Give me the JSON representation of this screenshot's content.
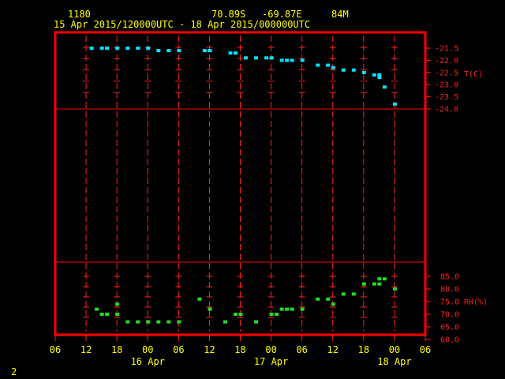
{
  "header": {
    "station_id": "1180",
    "lat": "70.89S",
    "lon": "-69.87E",
    "elevation": "84M",
    "time_range": "15 Apr 2015/120000UTC - 18 Apr 2015/000000UTC"
  },
  "page_number": "2",
  "colors": {
    "background": "#000000",
    "frame": "#ff0000",
    "grid": "#ff2020",
    "axis_text": "#ffff00",
    "temperature": "#00e5ff",
    "humidity": "#22dd22"
  },
  "chart_data": [
    {
      "type": "scatter",
      "panel": "top",
      "ylabel": "T(C)",
      "yticks": [
        "-21.5",
        "-22.0",
        "-22.5",
        "-23.0",
        "-23.5",
        "-24.0"
      ],
      "ylim": [
        -24.0,
        -21.5
      ],
      "y_inverted": true,
      "series": [
        {
          "points": [
            {
              "x": "2015-04-15T13:00",
              "y": -21.5
            },
            {
              "x": "2015-04-15T15:00",
              "y": -21.5
            },
            {
              "x": "2015-04-15T16:00",
              "y": -21.5
            },
            {
              "x": "2015-04-15T18:00",
              "y": -21.5
            },
            {
              "x": "2015-04-15T20:00",
              "y": -21.5
            },
            {
              "x": "2015-04-15T22:00",
              "y": -21.5
            },
            {
              "x": "2015-04-16T00:00",
              "y": -21.5
            },
            {
              "x": "2015-04-16T02:00",
              "y": -21.6
            },
            {
              "x": "2015-04-16T04:00",
              "y": -21.6
            },
            {
              "x": "2015-04-16T06:00",
              "y": -21.6
            },
            {
              "x": "2015-04-16T11:00",
              "y": -21.6
            },
            {
              "x": "2015-04-16T12:00",
              "y": -21.6
            },
            {
              "x": "2015-04-16T16:00",
              "y": -21.7
            },
            {
              "x": "2015-04-16T17:00",
              "y": -21.7
            },
            {
              "x": "2015-04-16T19:00",
              "y": -21.9
            },
            {
              "x": "2015-04-16T21:00",
              "y": -21.9
            },
            {
              "x": "2015-04-16T23:00",
              "y": -21.9
            },
            {
              "x": "2015-04-17T00:00",
              "y": -21.9
            },
            {
              "x": "2015-04-17T02:00",
              "y": -22.0
            },
            {
              "x": "2015-04-17T03:00",
              "y": -22.0
            },
            {
              "x": "2015-04-17T04:00",
              "y": -22.0
            },
            {
              "x": "2015-04-17T06:00",
              "y": -22.0
            },
            {
              "x": "2015-04-17T09:00",
              "y": -22.2
            },
            {
              "x": "2015-04-17T11:00",
              "y": -22.2
            },
            {
              "x": "2015-04-17T12:00",
              "y": -22.3
            },
            {
              "x": "2015-04-17T14:00",
              "y": -22.4
            },
            {
              "x": "2015-04-17T16:00",
              "y": -22.4
            },
            {
              "x": "2015-04-17T18:00",
              "y": -22.5
            },
            {
              "x": "2015-04-17T20:00",
              "y": -22.6
            },
            {
              "x": "2015-04-17T21:00",
              "y": -22.6
            },
            {
              "x": "2015-04-17T21:00",
              "y": -22.7
            },
            {
              "x": "2015-04-17T22:00",
              "y": -23.1
            },
            {
              "x": "2015-04-18T00:00",
              "y": -23.8
            }
          ]
        }
      ]
    },
    {
      "type": "scatter",
      "panel": "bottom",
      "ylabel": "RH(%)",
      "yticks": [
        "85.0",
        "80.0",
        "75.0",
        "70.0",
        "65.0",
        "60.0"
      ],
      "ylim": [
        60.0,
        85.0
      ],
      "series": [
        {
          "points": [
            {
              "x": "2015-04-15T14:00",
              "y": 72
            },
            {
              "x": "2015-04-15T15:00",
              "y": 70
            },
            {
              "x": "2015-04-15T16:00",
              "y": 70
            },
            {
              "x": "2015-04-15T18:00",
              "y": 74
            },
            {
              "x": "2015-04-15T18:00",
              "y": 70
            },
            {
              "x": "2015-04-15T20:00",
              "y": 67
            },
            {
              "x": "2015-04-15T22:00",
              "y": 67
            },
            {
              "x": "2015-04-16T00:00",
              "y": 67
            },
            {
              "x": "2015-04-16T02:00",
              "y": 67
            },
            {
              "x": "2015-04-16T04:00",
              "y": 67
            },
            {
              "x": "2015-04-16T06:00",
              "y": 67
            },
            {
              "x": "2015-04-16T10:00",
              "y": 76
            },
            {
              "x": "2015-04-16T12:00",
              "y": 72
            },
            {
              "x": "2015-04-16T15:00",
              "y": 67
            },
            {
              "x": "2015-04-16T17:00",
              "y": 70
            },
            {
              "x": "2015-04-16T18:00",
              "y": 70
            },
            {
              "x": "2015-04-16T21:00",
              "y": 67
            },
            {
              "x": "2015-04-17T00:00",
              "y": 70
            },
            {
              "x": "2015-04-17T01:00",
              "y": 70
            },
            {
              "x": "2015-04-17T02:00",
              "y": 72
            },
            {
              "x": "2015-04-17T03:00",
              "y": 72
            },
            {
              "x": "2015-04-17T04:00",
              "y": 72
            },
            {
              "x": "2015-04-17T06:00",
              "y": 72
            },
            {
              "x": "2015-04-17T09:00",
              "y": 76
            },
            {
              "x": "2015-04-17T11:00",
              "y": 76
            },
            {
              "x": "2015-04-17T12:00",
              "y": 74
            },
            {
              "x": "2015-04-17T14:00",
              "y": 78
            },
            {
              "x": "2015-04-17T16:00",
              "y": 78
            },
            {
              "x": "2015-04-17T18:00",
              "y": 82
            },
            {
              "x": "2015-04-17T20:00",
              "y": 82
            },
            {
              "x": "2015-04-17T21:00",
              "y": 84
            },
            {
              "x": "2015-04-17T21:00",
              "y": 82
            },
            {
              "x": "2015-04-17T22:00",
              "y": 84
            },
            {
              "x": "2015-04-18T00:00",
              "y": 80
            }
          ]
        }
      ]
    }
  ],
  "x_axis": {
    "ticks": [
      {
        "t": "2015-04-15T06:00",
        "label": "06"
      },
      {
        "t": "2015-04-15T12:00",
        "label": "12"
      },
      {
        "t": "2015-04-15T18:00",
        "label": "18"
      },
      {
        "t": "2015-04-16T00:00",
        "label": "00"
      },
      {
        "t": "2015-04-16T06:00",
        "label": "06"
      },
      {
        "t": "2015-04-16T12:00",
        "label": "12"
      },
      {
        "t": "2015-04-16T18:00",
        "label": "18"
      },
      {
        "t": "2015-04-17T00:00",
        "label": "00"
      },
      {
        "t": "2015-04-17T06:00",
        "label": "06"
      },
      {
        "t": "2015-04-17T12:00",
        "label": "12"
      },
      {
        "t": "2015-04-17T18:00",
        "label": "18"
      },
      {
        "t": "2015-04-18T00:00",
        "label": "00"
      },
      {
        "t": "2015-04-18T06:00",
        "label": "06"
      }
    ],
    "day_labels": [
      {
        "t": "2015-04-16T00:00",
        "label": "16 Apr"
      },
      {
        "t": "2015-04-17T00:00",
        "label": "17 Apr"
      },
      {
        "t": "2015-04-18T00:00",
        "label": "18 Apr"
      }
    ]
  }
}
